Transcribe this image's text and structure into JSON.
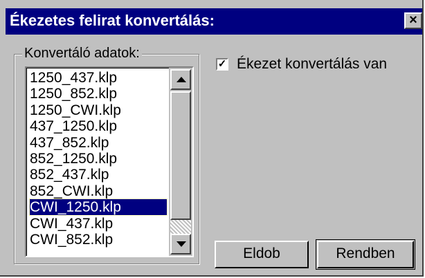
{
  "window": {
    "title": "Ékezetes felirat konvertálás:",
    "close_label": "×"
  },
  "group": {
    "label": "Konvertáló adatok:",
    "items": [
      "1250_437.klp",
      "1250_852.klp",
      "1250_CWI.klp",
      "437_1250.klp",
      "437_852.klp",
      "852_1250.klp",
      "852_437.klp",
      "852_CWI.klp",
      "CWI_1250.klp",
      "CWI_437.klp",
      "CWI_852.klp"
    ],
    "selected_item": "CWI_1250.klp"
  },
  "checkbox": {
    "checked": true,
    "mark": "✓",
    "label": "Ékezet konvertálás van"
  },
  "buttons": {
    "cancel_label": "Eldob",
    "ok_label": "Rendben"
  },
  "colors": {
    "titlebar": "#000080",
    "selection": "#000080",
    "face": "#c0c0c0"
  }
}
